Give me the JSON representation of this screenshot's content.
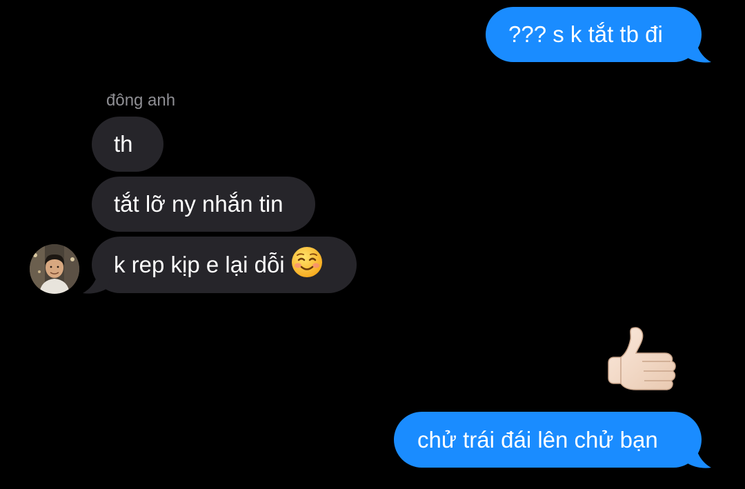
{
  "conversation": {
    "sender_name": "đông anh",
    "messages": [
      {
        "direction": "out",
        "text": "??? s k tắt tb đi"
      },
      {
        "direction": "in",
        "text": "th"
      },
      {
        "direction": "in",
        "text": "tắt lỡ ny nhắn tin"
      },
      {
        "direction": "in",
        "text": "k rep kịp e lại dỗi",
        "emoji": "smiling-face-icon"
      },
      {
        "direction": "out",
        "emoji": "thumbs-up-icon"
      },
      {
        "direction": "out",
        "text": "chử trái đái lên chử bạn"
      }
    ]
  },
  "colors": {
    "background": "#000000",
    "outgoing_bubble": "#1a8cff",
    "incoming_bubble": "#26252a",
    "sender_name": "#8e8e93",
    "text": "#ffffff"
  },
  "avatar": {
    "icon": "contact-avatar"
  }
}
